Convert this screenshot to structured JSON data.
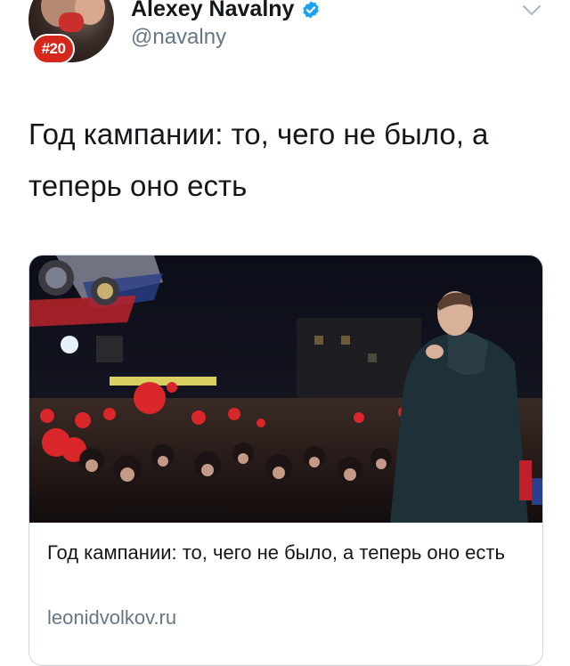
{
  "tweet": {
    "author": {
      "display_name": "Alexey Navalny",
      "handle": "@navalny",
      "avatar_badge": "#20",
      "verified": true
    },
    "text": "Год кампании: то, чего не было, а теперь оно есть",
    "menu_icon": "chevron-down-icon"
  },
  "link_card": {
    "title": "Год кампании: то, чего не было, а теперь оно есть",
    "domain": "leonidvolkov.ru",
    "image_alt": "rally-photo"
  },
  "colors": {
    "text": "#14171a",
    "secondary": "#657786",
    "verified": "#1da1f2",
    "border": "#ccd6dd",
    "badge": "#d6271c"
  }
}
